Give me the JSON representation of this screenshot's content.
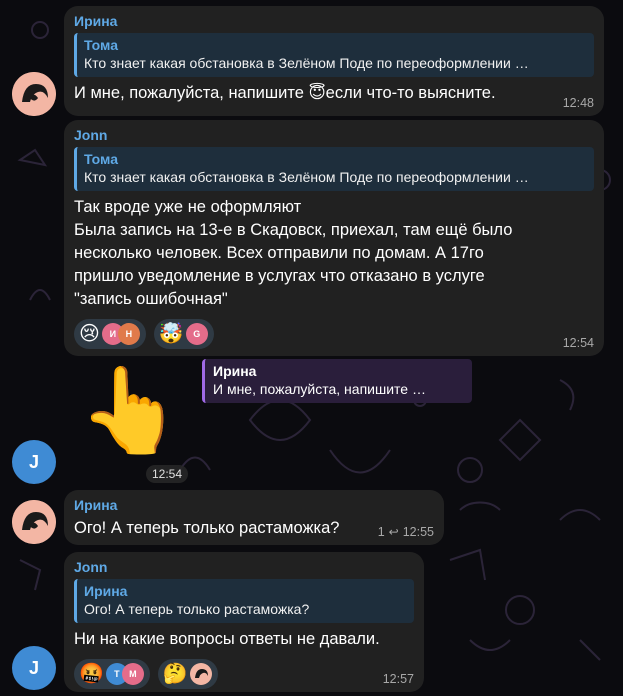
{
  "messages": [
    {
      "sender": "Ирина",
      "quote_name": "Тома",
      "quote_text": "Кто знает какая обстановка в Зелёном Поде по переоформлении …",
      "text": "И мне, пожалуйста, напишите 😇если что-то выясните.",
      "time": "12:48"
    },
    {
      "sender": "Jonn",
      "quote_name": "Тома",
      "quote_text": "Кто знает какая обстановка в Зелёном Поде по переоформлении …",
      "text_lines": [
        "Так вроде уже не оформляют",
        "Была запись на 13-е в Скадовск, приехал, там ещё было",
        "несколько человек. Всех отправили по домам. А 17го",
        "пришло уведомление в услугах что отказано в услуге",
        "\"запись ошибочная\""
      ],
      "reactions": [
        {
          "emoji": "😢",
          "avatars": [
            "И",
            "Н"
          ]
        },
        {
          "emoji": "🤯",
          "avatars": [
            "G"
          ]
        }
      ],
      "time": "12:54"
    },
    {
      "sender": "Jonn",
      "avatar_letter": "J",
      "reply_name": "Ирина",
      "reply_text": "И мне, пожалуйста, напишите …",
      "sticker": "👆",
      "time": "12:54"
    },
    {
      "sender": "Ирина",
      "text": "Ого! А теперь только растаможка?",
      "reply_count": "1",
      "time": "12:55"
    },
    {
      "sender": "Jonn",
      "avatar_letter": "J",
      "quote_name": "Ирина",
      "quote_text": "Ого! А теперь только растаможка?",
      "text": "Ни на какие вопросы ответы не давали.",
      "reactions": [
        {
          "emoji": "🤬",
          "avatars": [
            "T",
            "M"
          ]
        },
        {
          "emoji": "🤔",
          "avatars": [
            ""
          ]
        }
      ],
      "time": "12:57"
    }
  ],
  "colors": {
    "accent": "#5fa9e6",
    "bubble": "#212121",
    "background": "#0b0b0f",
    "reply_chip": "#2a1e3b"
  }
}
